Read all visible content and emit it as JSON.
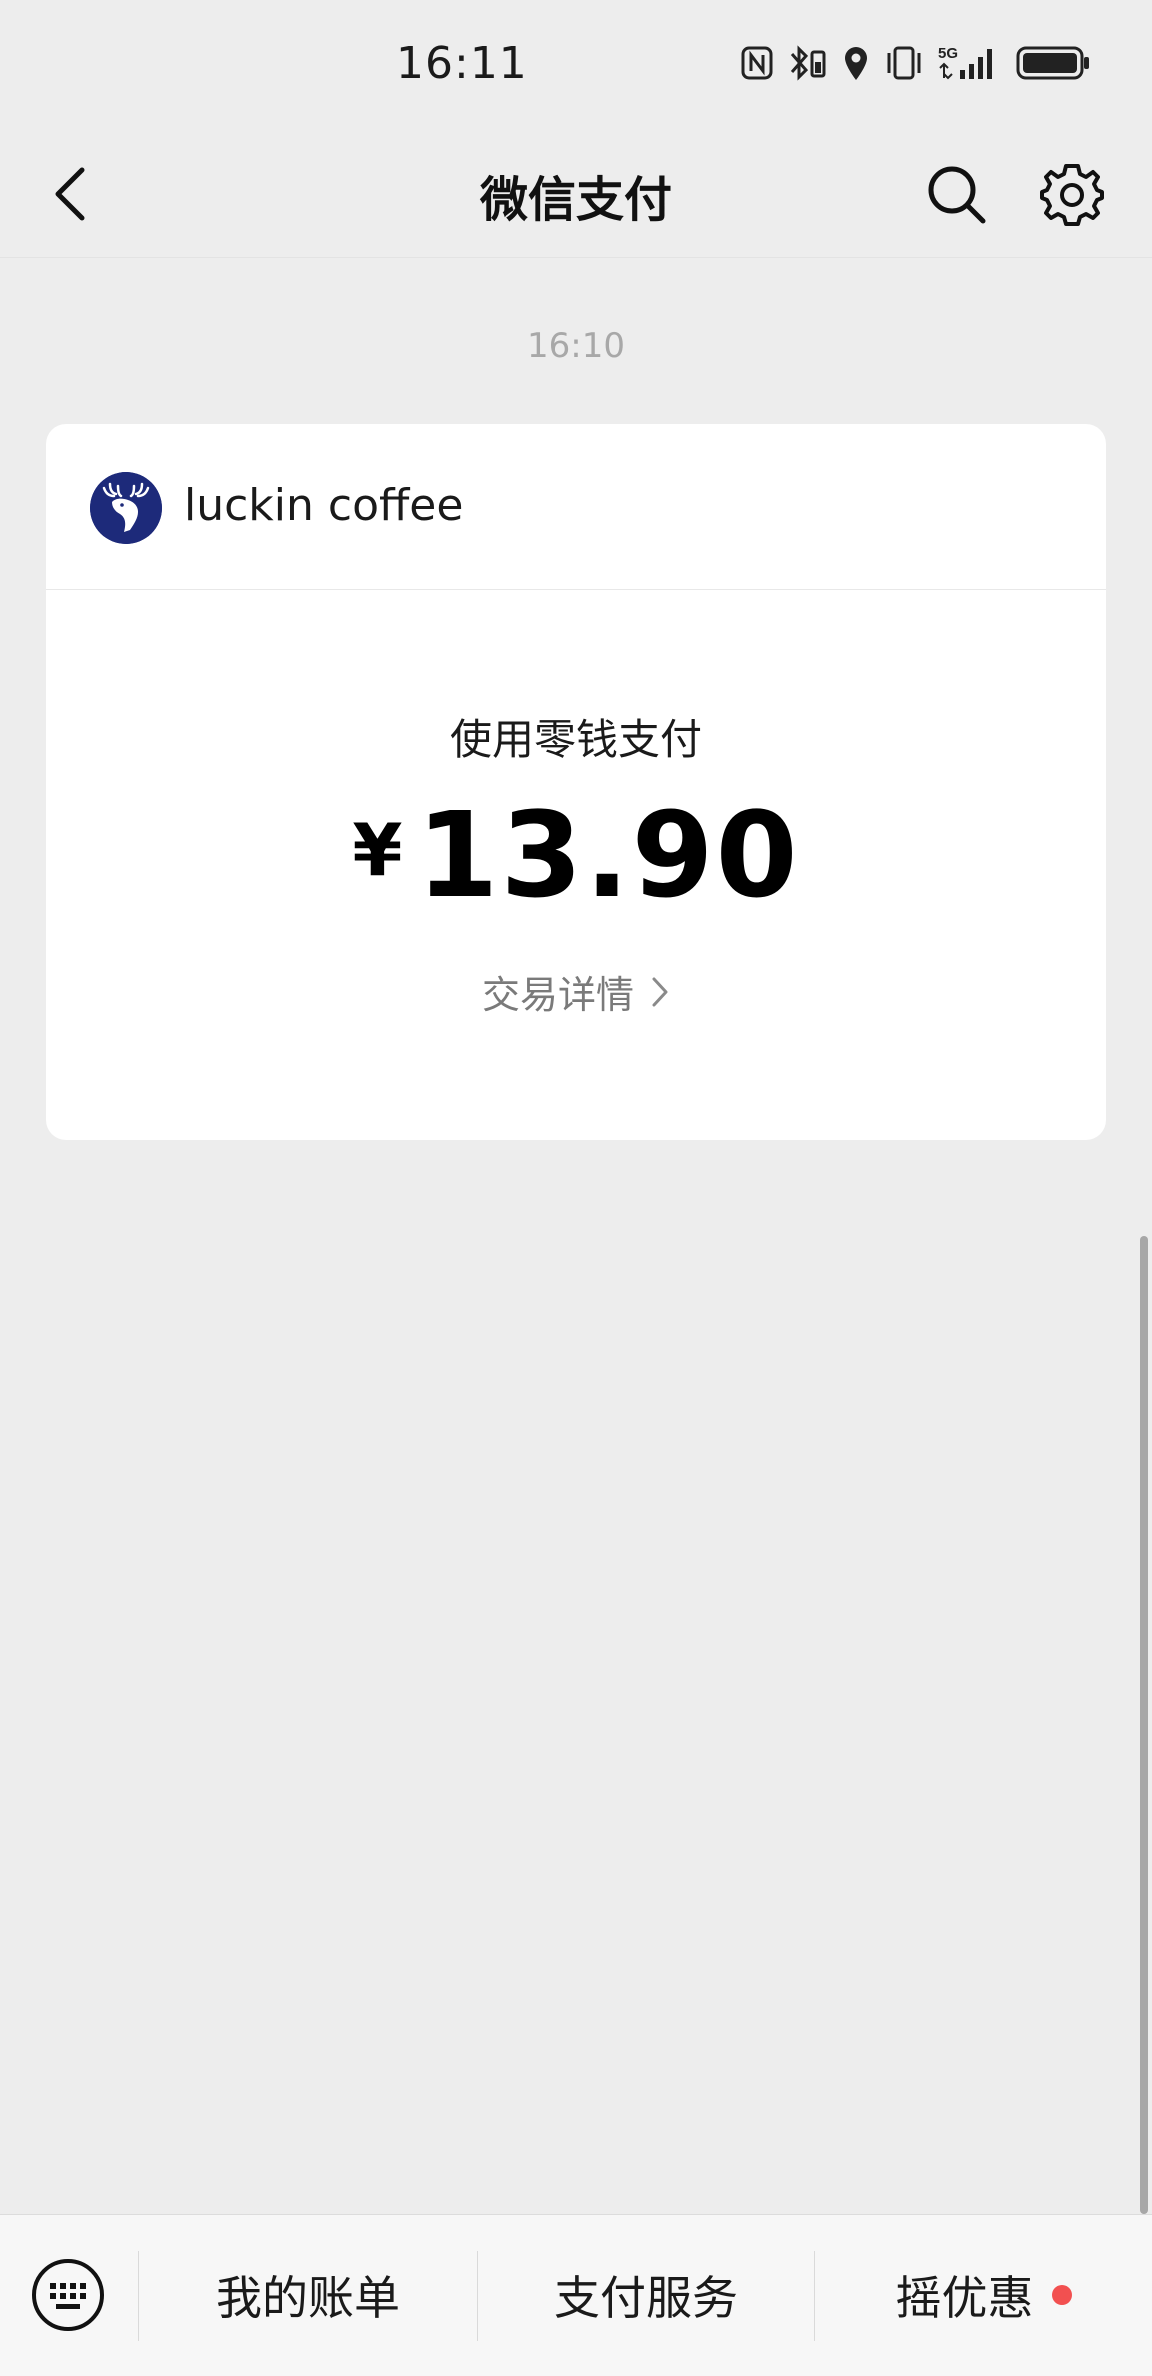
{
  "status_bar": {
    "time": "16:11",
    "network_label": "5G",
    "icons": [
      "nfc-icon",
      "bluetooth-icon",
      "location-icon",
      "vibrate-icon",
      "signal-icon",
      "battery-icon"
    ]
  },
  "nav": {
    "title": "微信支付",
    "back_icon": "chevron-left-icon",
    "search_icon": "search-icon",
    "settings_icon": "gear-icon"
  },
  "message": {
    "time": "16:10",
    "merchant": {
      "name": "luckin coffee",
      "logo_icon": "deer-logo-icon",
      "logo_color": "#1d2a7a"
    },
    "pay_method": "使用零钱支付",
    "amount": {
      "currency": "¥",
      "value": "13.90"
    },
    "detail_link": "交易详情"
  },
  "bottom_bar": {
    "keyboard_icon": "keyboard-icon",
    "tabs": [
      {
        "label": "我的账单",
        "has_dot": false
      },
      {
        "label": "支付服务",
        "has_dot": false
      },
      {
        "label": "摇优惠",
        "has_dot": true
      }
    ],
    "dot_color": "#f25050"
  }
}
